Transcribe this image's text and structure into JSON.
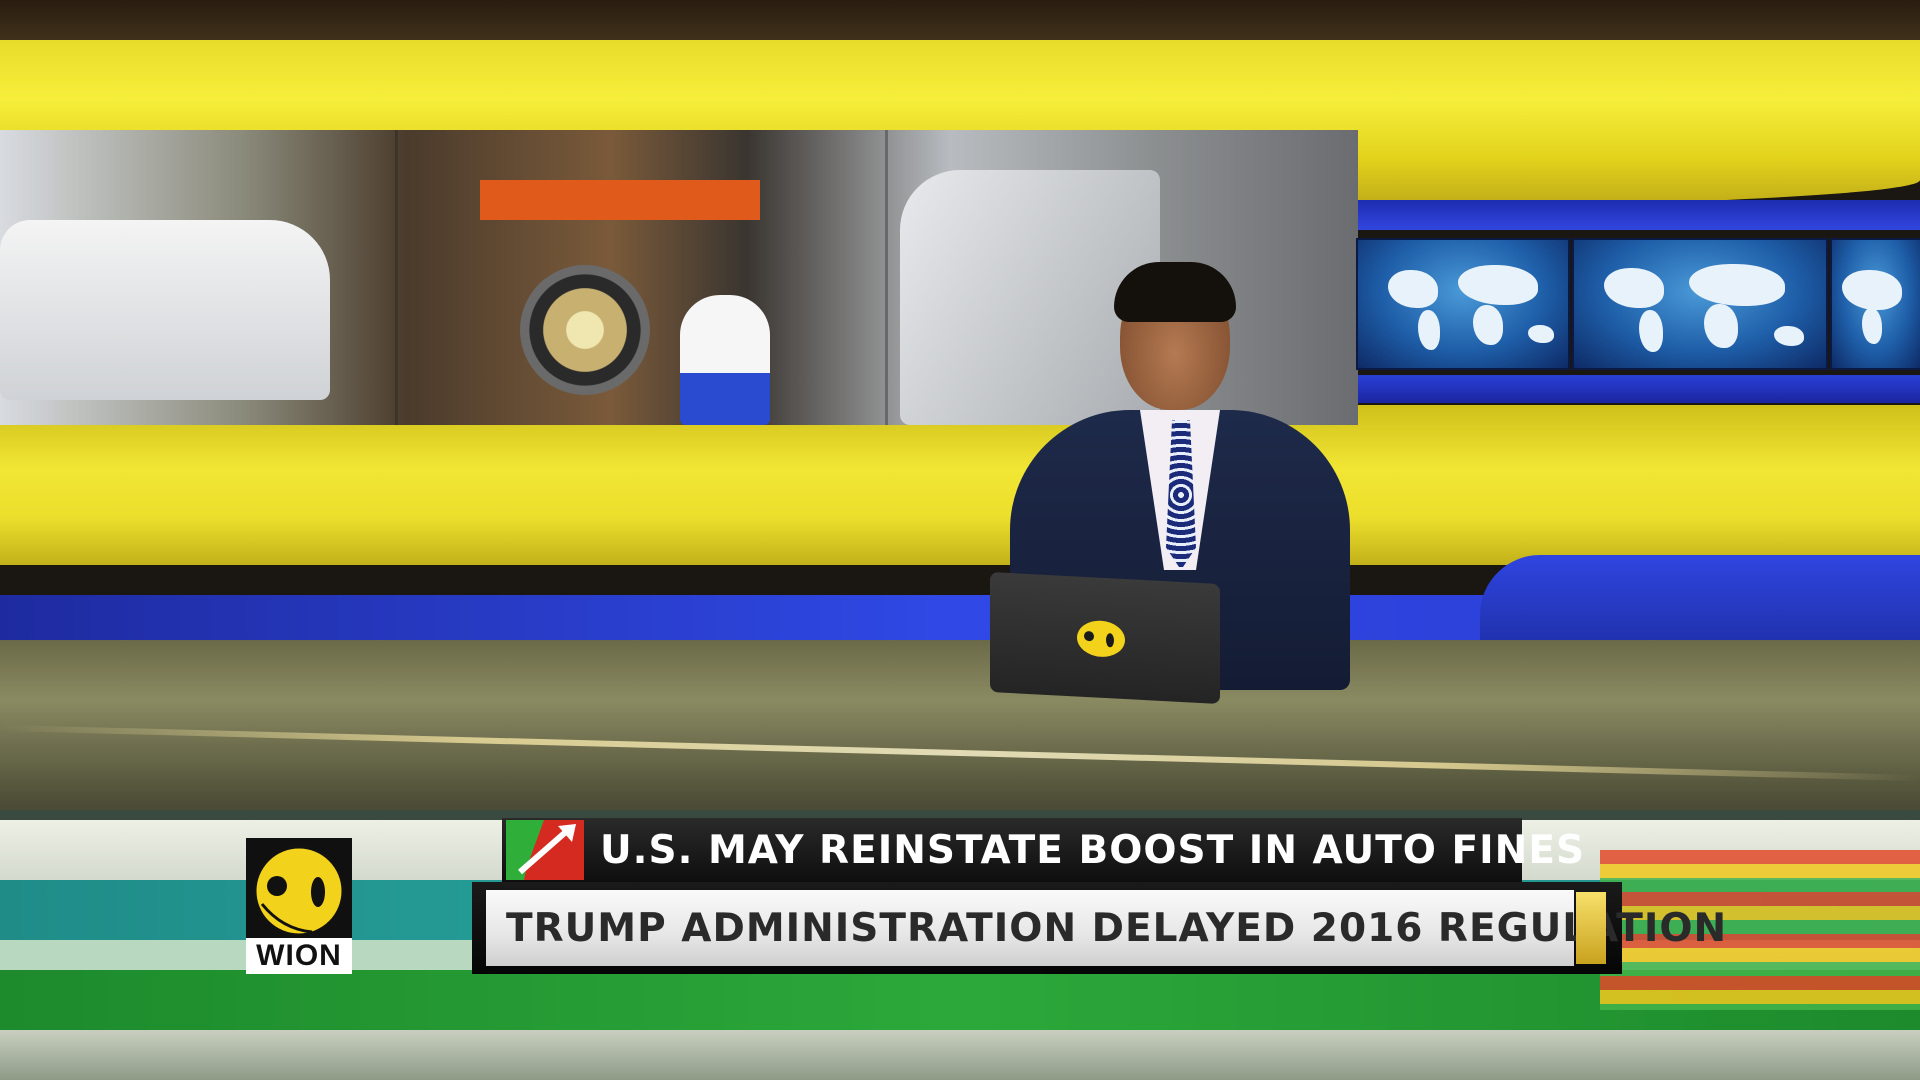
{
  "broadcast": {
    "channel_logo_text": "WION",
    "headline": "U.S. MAY REINSTATE BOOST IN AUTO FINES",
    "subheadline": "TRUMP ADMINISTRATION DELAYED 2016 REGULATION"
  },
  "icons": {
    "headline_icon": "trend-arrow-icon",
    "logo_mark": "wion-globe-icon"
  },
  "colors": {
    "brand_yellow": "#f6e000",
    "studio_blue": "#2b3fd6",
    "headline_bg": "#111111",
    "subhead_bg": "#eeeeee",
    "trend_green": "#2fae3a",
    "trend_red": "#d42a20"
  }
}
